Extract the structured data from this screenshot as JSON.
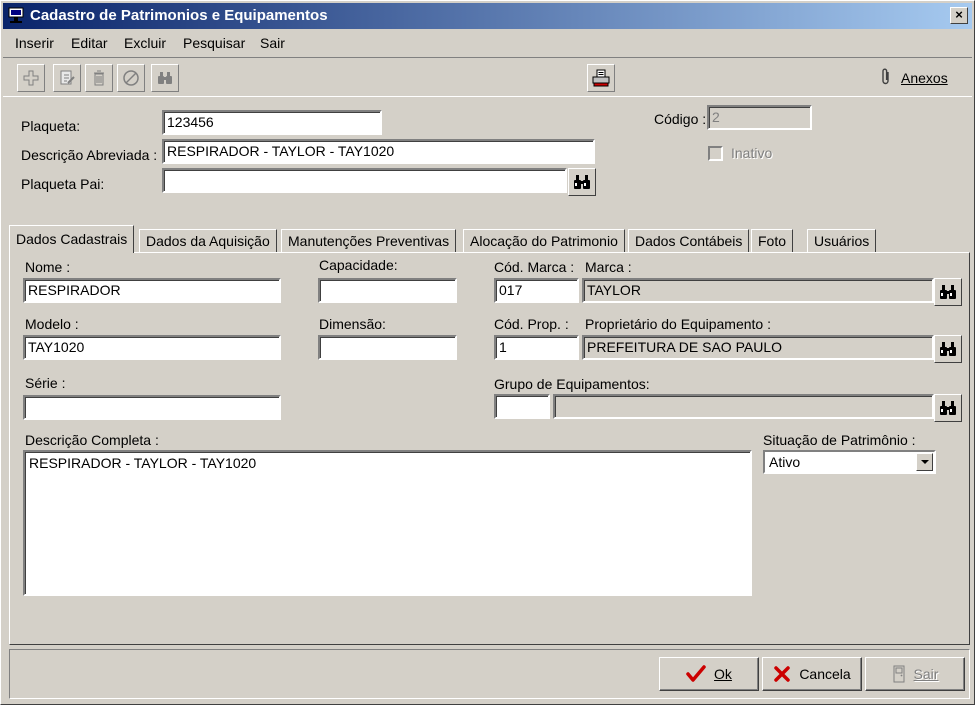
{
  "window": {
    "title": "Cadastro de Patrimonios e Equipamentos",
    "close_glyph": "×"
  },
  "menu": [
    {
      "label": "Inserir"
    },
    {
      "label": "Editar"
    },
    {
      "label": "Excluir"
    },
    {
      "label": "Pesquisar"
    },
    {
      "label": "Sair"
    }
  ],
  "toolbar": {
    "icons": [
      "add-icon",
      "edit-icon",
      "delete-icon",
      "cancel-icon",
      "binoculars-icon",
      "print-icon"
    ],
    "anexos_label": "Anexos"
  },
  "header": {
    "plaqueta_label": "Plaqueta:",
    "plaqueta_value": "123456",
    "descricao_label": "Descrição Abreviada :",
    "descricao_value": "RESPIRADOR - TAYLOR - TAY1020",
    "plaqueta_pai_label": "Plaqueta Pai:",
    "plaqueta_pai_value": "",
    "codigo_label": "Código :",
    "codigo_value": "2",
    "inativo_label": "Inativo"
  },
  "tabs": [
    {
      "label": "Dados Cadastrais",
      "active": true
    },
    {
      "label": "Dados da Aquisição"
    },
    {
      "label": "Manutenções Preventivas"
    },
    {
      "label": "Alocação do Patrimonio"
    },
    {
      "label": "Dados Contábeis"
    },
    {
      "label": "Foto"
    },
    {
      "label": "Usuários"
    }
  ],
  "form": {
    "nome_label": "Nome :",
    "nome_value": "RESPIRADOR",
    "capacidade_label": "Capacidade:",
    "capacidade_value": "",
    "cod_marca_label": "Cód. Marca :",
    "cod_marca_value": "017",
    "marca_label": "Marca :",
    "marca_value": "TAYLOR",
    "modelo_label": "Modelo :",
    "modelo_value": "TAY1020",
    "dimensao_label": "Dimensão:",
    "dimensao_value": "",
    "cod_prop_label": "Cód. Prop. :",
    "cod_prop_value": "1",
    "proprietario_label": "Proprietário do Equipamento :",
    "proprietario_value": "PREFEITURA DE SAO PAULO",
    "serie_label": "Série :",
    "serie_value": "",
    "grupo_label": "Grupo de Equipamentos:",
    "grupo_cod_value": "",
    "grupo_desc_value": "",
    "descricao_completa_label": "Descrição Completa :",
    "descricao_completa_value": "RESPIRADOR - TAYLOR - TAY1020",
    "situacao_label": "Situação de Patrimônio :",
    "situacao_value": "Ativo"
  },
  "buttons": {
    "ok_label": "Ok",
    "cancelar_label": "Cancela",
    "sair_label": "Sair"
  },
  "colors": {
    "title_start": "#0a246a",
    "title_end": "#a6caf0",
    "face": "#d4d0c8",
    "ok_check": "#cc0000",
    "cancel_x": "#cc0000"
  }
}
